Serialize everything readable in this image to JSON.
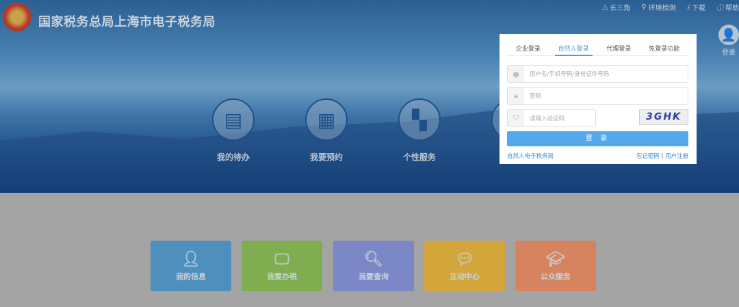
{
  "header": {
    "title": "国家税务总局上海市电子税务局",
    "links": [
      "长三角",
      "环境检测",
      "下载",
      "帮助"
    ],
    "login_label": "登录"
  },
  "services": [
    {
      "label": "我的待办",
      "icon": "todo-icon"
    },
    {
      "label": "我要预约",
      "icon": "calendar-icon"
    },
    {
      "label": "个性服务",
      "icon": "grid-icon"
    }
  ],
  "login": {
    "tabs": [
      "企业登录",
      "自然人登录",
      "代理登录",
      "免登录功能"
    ],
    "active_tab": 1,
    "username_placeholder": "用户名/手机号码/身份证件号码",
    "password_placeholder": "密码",
    "captcha_placeholder": "请输入验证码",
    "captcha_text": "3GHK",
    "submit": "登 录",
    "natural_link": "自然人电子税务局",
    "forgot": "忘记密码",
    "sep": "|",
    "register": "用户注册",
    "accent": "#52a9ee"
  },
  "tiles": [
    {
      "label": "我的信息",
      "color": "#4f8fbe"
    },
    {
      "label": "我要办税",
      "color": "#7fad4f"
    },
    {
      "label": "我要查询",
      "color": "#7b87c6"
    },
    {
      "label": "互动中心",
      "color": "#d3a63c"
    },
    {
      "label": "公众服务",
      "color": "#d6845f"
    }
  ]
}
